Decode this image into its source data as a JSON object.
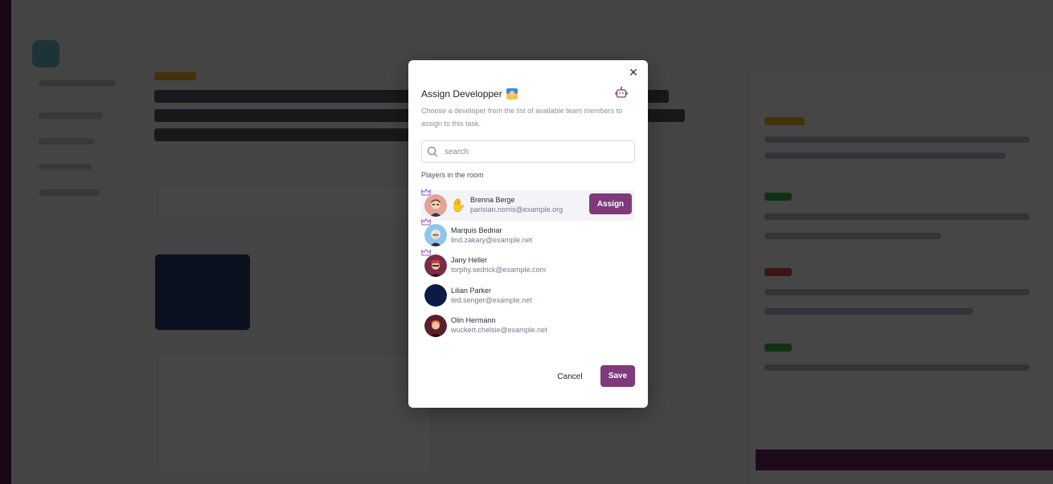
{
  "modal": {
    "title": "Assign Developper",
    "title_icon": "developer-emoji-icon",
    "subtitle": "Choose a developer from the list of available team members to assign to this task.",
    "close_icon": "close-icon",
    "robot_icon": "robot-icon",
    "search": {
      "placeholder": "search",
      "value": ""
    },
    "section_label": "Players in the room",
    "players": [
      {
        "name": "Brenna Berge",
        "email": "parisian.norris@example.org",
        "crown": true,
        "hand_raised": true,
        "assign_label": "Assign",
        "avatar_color": "#e3a39a"
      },
      {
        "name": "Marquis Bednar",
        "email": "lind.zakary@example.net",
        "crown": true,
        "hand_raised": false,
        "avatar_color": "#8fc5ea"
      },
      {
        "name": "Jany Heller",
        "email": "torphy.sedrick@example.com",
        "crown": true,
        "hand_raised": false,
        "avatar_color": "#7a2c47"
      },
      {
        "name": "Lilian Parker",
        "email": "ted.senger@example.net",
        "crown": false,
        "hand_raised": false,
        "avatar_color": "#0c1a47"
      },
      {
        "name": "Olin Hermann",
        "email": "wuckert.chelsie@example.net",
        "crown": false,
        "hand_raised": false,
        "avatar_color": "#5a1e2c"
      }
    ],
    "cancel_label": "Cancel",
    "save_label": "Save"
  },
  "colors": {
    "accent": "#7e3a7b",
    "overlay": "rgba(0,0,0,0.72)",
    "crown": "#9b5cc9"
  }
}
